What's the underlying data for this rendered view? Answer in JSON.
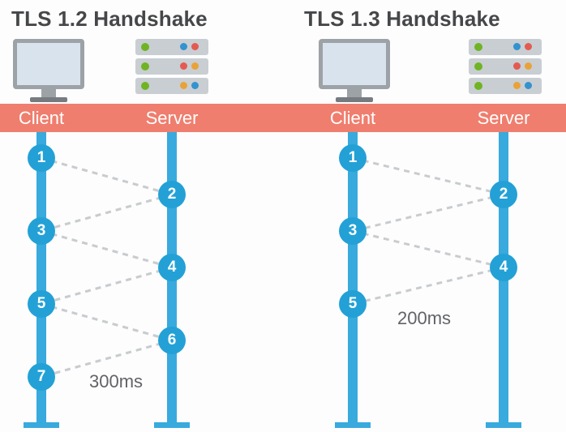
{
  "chart_data": {
    "type": "diagram",
    "panels": [
      {
        "title": "TLS 1.2 Handshake",
        "actors": [
          "Client",
          "Server"
        ],
        "steps": [
          {
            "n": 1,
            "side": "Client"
          },
          {
            "n": 2,
            "side": "Server"
          },
          {
            "n": 3,
            "side": "Client"
          },
          {
            "n": 4,
            "side": "Server"
          },
          {
            "n": 5,
            "side": "Client"
          },
          {
            "n": 6,
            "side": "Server"
          },
          {
            "n": 7,
            "side": "Client"
          }
        ],
        "elapsed_label": "300ms"
      },
      {
        "title": "TLS 1.3 Handshake",
        "actors": [
          "Client",
          "Server"
        ],
        "steps": [
          {
            "n": 1,
            "side": "Client"
          },
          {
            "n": 2,
            "side": "Server"
          },
          {
            "n": 3,
            "side": "Client"
          },
          {
            "n": 4,
            "side": "Server"
          },
          {
            "n": 5,
            "side": "Client"
          }
        ],
        "elapsed_label": "200ms"
      }
    ]
  },
  "titles": {
    "left": "TLS 1.2 Handshake",
    "right": "TLS 1.3 Handshake"
  },
  "band": {
    "c1": "Client",
    "s1": "Server",
    "c2": "Client",
    "s2": "Server"
  },
  "steps": {
    "1": "1",
    "2": "2",
    "3": "3",
    "4": "4",
    "5": "5",
    "6": "6",
    "7": "7"
  },
  "times": {
    "left": "300ms",
    "right": "200ms"
  }
}
